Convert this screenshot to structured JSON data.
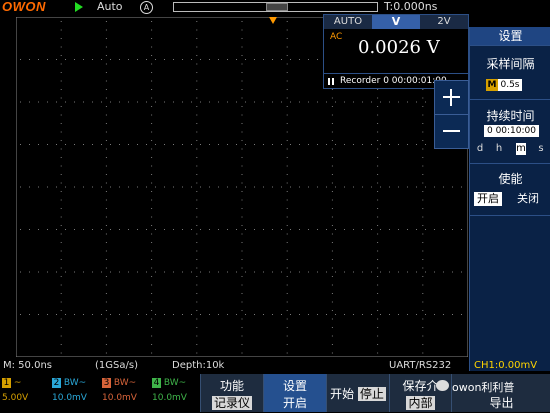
{
  "topbar": {
    "logo": "OWON",
    "trigger_mode": "Auto",
    "trigger_source": "A",
    "trigger_time": "T:0.000ns"
  },
  "measure_panel": {
    "tabs": [
      "AUTO",
      "V",
      "2V"
    ],
    "coupling": "AC",
    "value": "0.0026 V",
    "recorder": "Recorder 0 00:00:01:00"
  },
  "side_menu": {
    "title": "设置",
    "sample_interval_label": "采样间隔",
    "sample_interval_mode": "M",
    "sample_interval_value": "0.5s",
    "duration_label": "持续时间",
    "duration_value": "0 00:10:00",
    "duration_units": [
      "d",
      "h",
      "m",
      "s"
    ],
    "enable_label": "使能",
    "enable_on": "开启",
    "enable_off": "关闭"
  },
  "status": {
    "timebase": "M: 50.0ns",
    "sample_rate": "(1GSa/s)",
    "depth": "Depth:10k",
    "trigger_type": "UART/RS232",
    "ch1_level": "CH1:0.00mV"
  },
  "channels": [
    {
      "num": "1",
      "coupling": "~",
      "scale": "5.00V",
      "color": "#d6a000"
    },
    {
      "num": "2",
      "coupling": "BW~",
      "scale": "10.0mV",
      "color": "#2aa8d8"
    },
    {
      "num": "3",
      "coupling": "BW~",
      "scale": "10.0mV",
      "color": "#d8643a"
    },
    {
      "num": "4",
      "coupling": "BW~",
      "scale": "10.0mV",
      "color": "#3fb44a"
    }
  ],
  "bottom_menu": {
    "func_l1": "功能",
    "func_l2": "记录仪",
    "setup_l1": "设置",
    "setup_l2": "开启",
    "start_l1": "开始",
    "start_l2": "停止",
    "save_l1": "保存介",
    "save_l2": "内部",
    "back_l2": "导出"
  },
  "watermark": "owon利利普",
  "colors": {
    "accent": "#ff6a00",
    "menu_bg": "#0a2246",
    "grid": "#7a7a7a"
  }
}
